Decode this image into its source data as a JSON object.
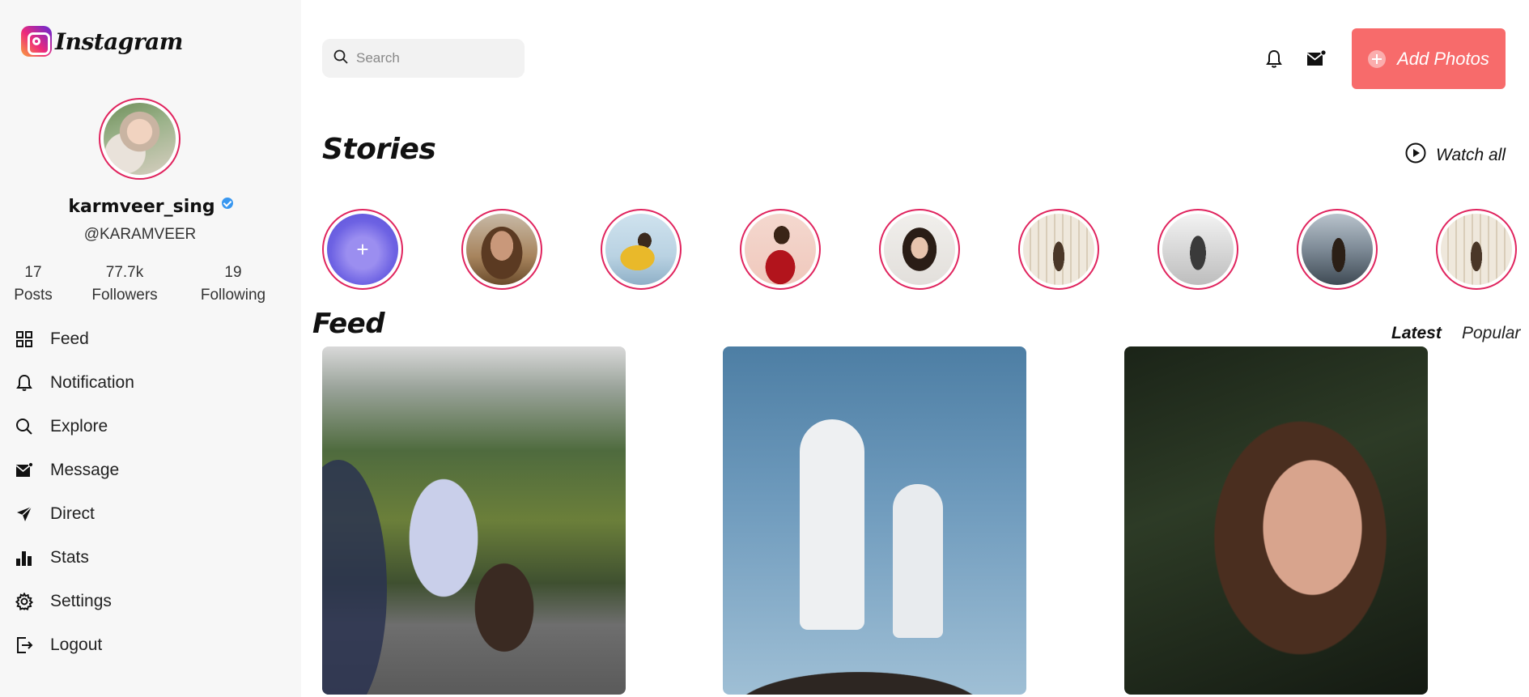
{
  "app": {
    "logo_text": "Instagram"
  },
  "profile": {
    "username": "karmveer_sing",
    "handle": "@KARAMVEER",
    "stats": [
      {
        "value": "17",
        "label": "Posts"
      },
      {
        "value": "77.7k",
        "label": "Followers"
      },
      {
        "value": "19",
        "label": "Following"
      }
    ]
  },
  "nav": {
    "items": [
      {
        "label": "Feed",
        "icon": "grid-icon"
      },
      {
        "label": "Notification",
        "icon": "bell-icon"
      },
      {
        "label": "Explore",
        "icon": "search-icon"
      },
      {
        "label": "Message",
        "icon": "mail-icon"
      },
      {
        "label": "Direct",
        "icon": "send-icon"
      },
      {
        "label": "Stats",
        "icon": "bar-chart-icon"
      },
      {
        "label": "Settings",
        "icon": "gear-icon"
      },
      {
        "label": "Logout",
        "icon": "logout-icon"
      }
    ]
  },
  "header": {
    "search_placeholder": "Search",
    "add_button_label": "Add Photos"
  },
  "stories": {
    "title": "Stories",
    "watch_all_label": "Watch all"
  },
  "feed": {
    "title": "Feed",
    "tabs": [
      {
        "label": "Latest",
        "active": true
      },
      {
        "label": "Popular",
        "active": false
      }
    ]
  },
  "colors": {
    "accent": "#f76b6b",
    "story_ring": "#e0245e",
    "verified": "#3897f0",
    "sidebar_bg": "#f7f7f7"
  }
}
